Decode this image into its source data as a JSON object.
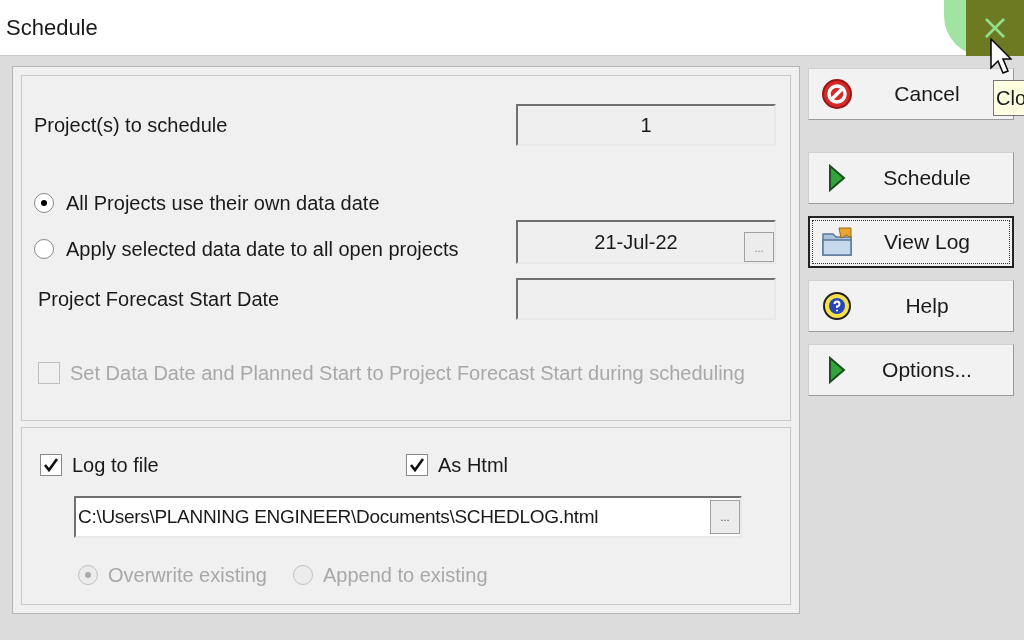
{
  "window": {
    "title": "Schedule"
  },
  "tooltip": {
    "text": "Clo"
  },
  "projects_to_schedule": {
    "label": "Project(s) to schedule",
    "value": "1"
  },
  "data_date_options": [
    {
      "label": "All Projects use their own data date",
      "selected": true
    },
    {
      "label": "Apply selected data date to all open projects",
      "selected": false
    }
  ],
  "data_date": {
    "value": "21-Jul-22",
    "browse": "..."
  },
  "forecast_start": {
    "label": "Project Forecast Start Date"
  },
  "set_data_date": {
    "label": "Set Data Date and Planned Start to Project Forecast Start during scheduling",
    "checked": false,
    "disabled": true
  },
  "log_to_file": {
    "label": "Log to file",
    "checked": true
  },
  "as_html": {
    "label": "As Html",
    "checked": true
  },
  "log_path": {
    "value": "C:\\Users\\PLANNING ENGINEER\\Documents\\SCHEDLOG.html",
    "browse": "..."
  },
  "write_mode": [
    {
      "label": "Overwrite existing",
      "selected": true,
      "disabled": true
    },
    {
      "label": "Append to existing",
      "selected": false,
      "disabled": true
    }
  ],
  "buttons": [
    {
      "label": "Cancel",
      "kind": "stop",
      "focused": false
    },
    {
      "label": "Schedule",
      "kind": "play",
      "focused": false
    },
    {
      "label": "View Log",
      "kind": "folder",
      "focused": true
    },
    {
      "label": "Help",
      "kind": "help",
      "focused": false
    },
    {
      "label": "Options...",
      "kind": "play",
      "focused": false
    }
  ]
}
